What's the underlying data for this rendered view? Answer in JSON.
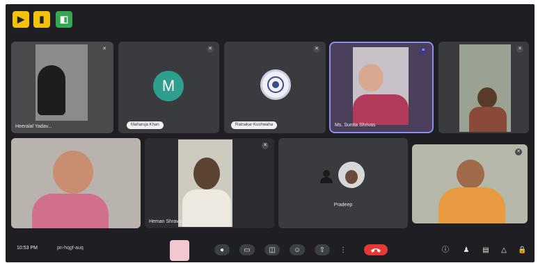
{
  "colors": {
    "app_bg": "#1f1f23",
    "tile_bg": "#3a3b3f",
    "active_border": "#8d8ff5",
    "end_call": "#e53935",
    "avatar_green": "#2e9e8f"
  },
  "top_icons": [
    {
      "name": "yellow-app-icon",
      "label": "▶"
    },
    {
      "name": "yellow-note-icon",
      "label": "▮"
    },
    {
      "name": "green-app-icon",
      "label": "◧"
    }
  ],
  "participants": {
    "tile1": {
      "name": "Heeralal Yadav..."
    },
    "tile2": {
      "initial": "M",
      "name": "Maharuja Khan"
    },
    "tile3": {
      "name": "Ratnakar Kushwaha"
    },
    "tile4": {
      "name": "Ms. Sunita Shrivas"
    },
    "tile5": {
      "name": ""
    },
    "tile6": {
      "name": ""
    },
    "tile7": {
      "name": "Heman Shravankar"
    },
    "tile8": {
      "name": "Pradeep"
    },
    "tile9": {
      "name": ""
    }
  },
  "bottom_bar": {
    "time": "10:53 PM",
    "meeting_code": "pn-hqgf-auq",
    "controls": [
      "mic-icon",
      "camera-icon",
      "captions-icon",
      "emoji-icon",
      "present-icon",
      "raise-hand-icon",
      "more-icon"
    ],
    "right_controls": [
      "info-icon",
      "people-icon",
      "chat-icon",
      "activities-icon",
      "host-controls-icon"
    ]
  }
}
